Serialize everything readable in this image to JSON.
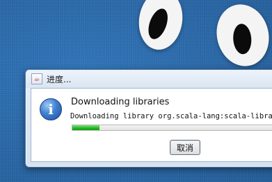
{
  "window": {
    "title": "进度...",
    "icon": "java-app-icon"
  },
  "message": {
    "icon": "info-icon",
    "title": "Downloading libraries",
    "detail": "Downloading library org.scala-lang:scala-library"
  },
  "progress": {
    "fraction": 0.13,
    "color": "#1fb51f"
  },
  "buttons": {
    "cancel_label": "取消"
  }
}
